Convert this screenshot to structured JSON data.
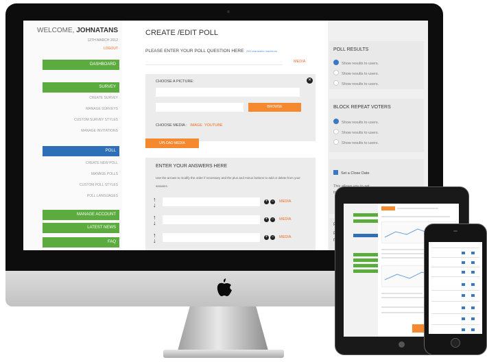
{
  "sidebar": {
    "welcome_prefix": "WELCOME,",
    "username": "JOHNATANS",
    "date": "12TH MARCH 2012",
    "logout": "LOGOUT",
    "dashboard": "DASHBOARD",
    "survey": "SURVEY",
    "survey_items": [
      "CREATE SURVEY",
      "MANAGE SURVEYS",
      "CUSTOM SURVEY STYLES",
      "MANAGE INVITATIONS"
    ],
    "poll": "POLL",
    "poll_items": [
      "CREATE NEW POLL",
      "MANAGE POLLS",
      "CUSTOM POLL STYLES",
      "POLL LANGUAGES"
    ],
    "manage_account": "MANAGE ACCOUNT",
    "latest_news": "LATEST NEWS",
    "faq": "FAQ"
  },
  "main": {
    "title": "CREATE /EDIT POLL",
    "question_label": "PLEASE ENTER YOUR POLL QUESTION HERE",
    "question_hint": "255 characters maximum",
    "media": "MEDIA",
    "choose_picture": "CHOOSE A PICTURE:",
    "browse": "BROWSE",
    "choose_media": "CHOOSE MEDIA :",
    "media_image": "IMAGE",
    "media_youtube": "YOUTUBE",
    "upload_media": "UPLOAD MEDIA",
    "answers_title": "ENTER YOUR ANSWERS HERE",
    "answers_help": "Use the arrows to modify the order if necessary and the plus and minus buttons to add or delete from your answers.",
    "answer_rows": [
      "",
      "",
      ""
    ]
  },
  "right": {
    "poll_results": "POLL RESULTS",
    "results_options": [
      "Show results to users.",
      "Show results to users.",
      "Show results to users."
    ],
    "block_repeat": "BLOCK REPEAT VOTERS",
    "block_options": [
      "Show results to users.",
      "Show results to users.",
      "Show results to users."
    ],
    "set_close_date": "Set a Close Date",
    "close_desc": "This allows you to set the",
    "poll_p1": "P",
    "poll_p2": "P",
    "poll_p3": "fo"
  },
  "colors": {
    "green": "#5cab3e",
    "blue": "#2f6fb8",
    "orange": "#f4892f"
  }
}
